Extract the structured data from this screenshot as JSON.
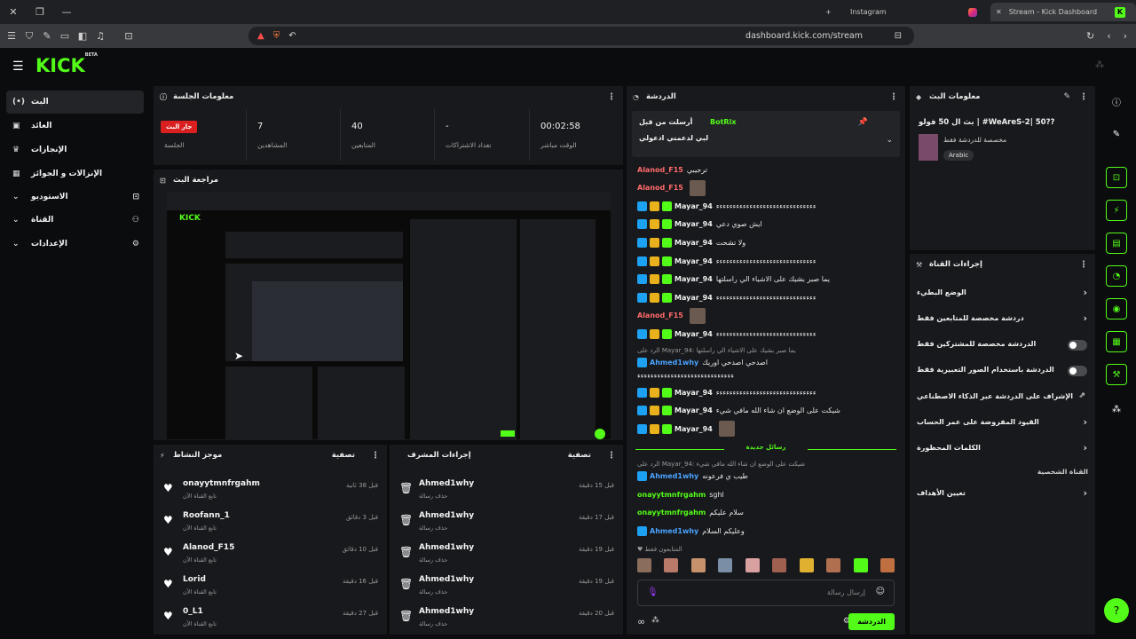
{
  "browser": {
    "tabs": [
      {
        "label": "Instagram"
      },
      {
        "label": "Stream - Kick Dashboard"
      }
    ],
    "url": "dashboard.kick.com/stream"
  },
  "app": {
    "logo": "KICK",
    "logo_tag": "BETA"
  },
  "sidebar": {
    "items": [
      {
        "label": "البث",
        "icon": "broadcast-icon"
      },
      {
        "label": "العائد",
        "icon": "wallet-icon"
      },
      {
        "label": "الإنجازات",
        "icon": "trophy-icon"
      },
      {
        "label": "الإنزالات و الجوائز",
        "icon": "gift-icon"
      },
      {
        "label": "الاستوديو",
        "icon": "studio-icon"
      },
      {
        "label": "القناة",
        "icon": "channel-icon"
      },
      {
        "label": "الإعدادات",
        "icon": "gear-icon"
      }
    ]
  },
  "session": {
    "title": "معلومات الجلسة",
    "live_badge": "جار البث",
    "live_label": "الجلسة",
    "stats": [
      {
        "value": "7",
        "label": "المشاهدين"
      },
      {
        "value": "40",
        "label": "المتابعين"
      },
      {
        "value": "-",
        "label": "تعداد الاشتراكات"
      },
      {
        "value": "00:02:58",
        "label": "الوقت مباشر"
      }
    ]
  },
  "preview": {
    "title": "مراجعة البث"
  },
  "activity": {
    "title": "موجز النشاط",
    "filter": "تصفية",
    "rows": [
      {
        "name": "onayytmnfrgahm",
        "sub": "تابع القناة الآن",
        "time": "قبل 38 ثانية"
      },
      {
        "name": "Roofann_1",
        "sub": "تابع القناة الآن",
        "time": "قبل 3 دقائق"
      },
      {
        "name": "Alanod_F15",
        "sub": "تابع القناة الآن",
        "time": "قبل 10 دقائق"
      },
      {
        "name": "Lorid",
        "sub": "تابع القناة الآن",
        "time": "قبل 16 دقيقة"
      },
      {
        "name": "0_L1",
        "sub": "تابع القناة الآن",
        "time": "قبل 27 دقيقة"
      }
    ]
  },
  "modlog": {
    "title": "إجراءات المشرف",
    "filter": "تصفية",
    "rows": [
      {
        "name": "Ahmed1why",
        "sub": "حذف رسالة",
        "time": "قبل 15 دقيقة"
      },
      {
        "name": "Ahmed1why",
        "sub": "حذف رسالة",
        "time": "قبل 17 دقيقة"
      },
      {
        "name": "Ahmed1why",
        "sub": "حذف رسالة",
        "time": "قبل 19 دقيقة"
      },
      {
        "name": "Ahmed1why",
        "sub": "حذف رسالة",
        "time": "قبل 19 دقيقة"
      },
      {
        "name": "Ahmed1why",
        "sub": "حذف رسالة",
        "time": "قبل 20 دقيقة"
      }
    ]
  },
  "chat": {
    "title": "الدردشة",
    "pinned": {
      "title": "أرسلت من قبل",
      "user": "BotRix",
      "message": "لبي لدعمني ادعولي"
    },
    "messages": [
      {
        "user": "Alanod_F15",
        "color": "#ff6b6b",
        "text": "ترجيبي",
        "badges": []
      },
      {
        "user": "Alanod_F15",
        "color": "#ff6b6b",
        "text": "",
        "badges": [],
        "emote": true
      },
      {
        "user": "Mayar_94",
        "color": "#f0f0f0",
        "text": "ءءءءءءءءءءءءءءءءءءءءءءءءءءءءءء",
        "badges": [
          "mod",
          "sub",
          "vip"
        ]
      },
      {
        "user": "Mayar_94",
        "color": "#f0f0f0",
        "text": "ايش صوي دعي",
        "badges": [
          "mod",
          "sub",
          "vip"
        ]
      },
      {
        "user": "Mayar_94",
        "color": "#f0f0f0",
        "text": "ولا تشحت",
        "badges": [
          "mod",
          "sub",
          "vip"
        ]
      },
      {
        "user": "Mayar_94",
        "color": "#f0f0f0",
        "text": "ءءءءءءءءءءءءءءءءءءءءءءءءءءءءءء",
        "badges": [
          "mod",
          "sub",
          "vip"
        ]
      },
      {
        "user": "Mayar_94",
        "color": "#f0f0f0",
        "text": "يما صبر بشيك على الاشياء الي راسلتها",
        "badges": [
          "mod",
          "sub",
          "vip"
        ]
      },
      {
        "user": "Mayar_94",
        "color": "#f0f0f0",
        "text": "ءءءءءءءءءءءءءءءءءءءءءءءءءءءءءء",
        "badges": [
          "mod",
          "sub",
          "vip"
        ]
      },
      {
        "user": "Alanod_F15",
        "color": "#ff6b6b",
        "text": "",
        "badges": [],
        "emote": true
      },
      {
        "user": "Mayar_94",
        "color": "#f0f0f0",
        "text": "ءءءءءءءءءءءءءءءءءءءءءءءءءءءءءء",
        "badges": [
          "mod",
          "sub",
          "vip"
        ]
      }
    ],
    "reply1": "الرد على Mayar_94: يما صبر بشيك على الاشياء الي راسلتها",
    "reply1_msg": {
      "user": "Ahmed1why",
      "text": "اصدحي اصدحي اوريك"
    },
    "plain_line": "ءءءءءءءءءءءءءءءءءءءءءءءءءءءءء",
    "messages2": [
      {
        "user": "Mayar_94",
        "text": "ءءءءءءءءءءءءءءءءءءءءءءءءءءءءءء"
      },
      {
        "user": "Mayar_94",
        "text": "شيكت على الوضع ان شاء الله مافي شيء"
      },
      {
        "user": "Mayar_94",
        "text": "",
        "emote": true
      }
    ],
    "new_messages": "رسائل جديدة",
    "reply2": "الرد على Mayar_94: شيكت على الوضع ان شاء الله مافي شيء",
    "reply2_msg": {
      "user": "Ahmed1why",
      "text": "طيب ي فرعونه"
    },
    "messages3": [
      {
        "user": "onayytmnfrgahm",
        "text": "sghl",
        "color": "#53fc18"
      },
      {
        "user": "onayytmnfrgahm",
        "text": "سلام عليكم",
        "color": "#53fc18"
      },
      {
        "user": "Ahmed1why",
        "text": "وعليكم السلام",
        "color": "#4aa3ff"
      }
    ],
    "followers_only": "المتابعون فقط",
    "input_placeholder": "إرسال رسالة",
    "send_label": "الدردشة"
  },
  "stream_info": {
    "title": "معلومات البث",
    "stream_title": "بث ال 50 فولو | #WeAreS-2| 50??",
    "category": "مخصصة للدردشة فقط",
    "tag": "Arabic"
  },
  "channel_actions": {
    "title": "إجراءات القناة",
    "rows": [
      {
        "label": "الوضع البطيء",
        "type": "chevron"
      },
      {
        "label": "دردشة مخصصة للمتابعين فقط",
        "type": "chevron"
      },
      {
        "label": "الدردشة مخصصة للمشتركين فقط",
        "type": "toggle"
      },
      {
        "label": "الدردشة باستخدام الصور التعبيرية فقط",
        "type": "toggle"
      },
      {
        "label": "الإشراف على الدردشة عبر الذكاء الاصطناعي",
        "type": "external"
      },
      {
        "label": "القيود المفروضة على عمر الحساب",
        "type": "chevron"
      },
      {
        "label": "الكلمات المحظورة",
        "type": "chevron"
      }
    ],
    "section": "القناة الشخصية",
    "goals": "تعيين الأهداف"
  },
  "colors": {
    "accent": "#53fc18",
    "live": "#d91f1f",
    "panel": "#18191c",
    "bg": "#0b0c0e"
  }
}
